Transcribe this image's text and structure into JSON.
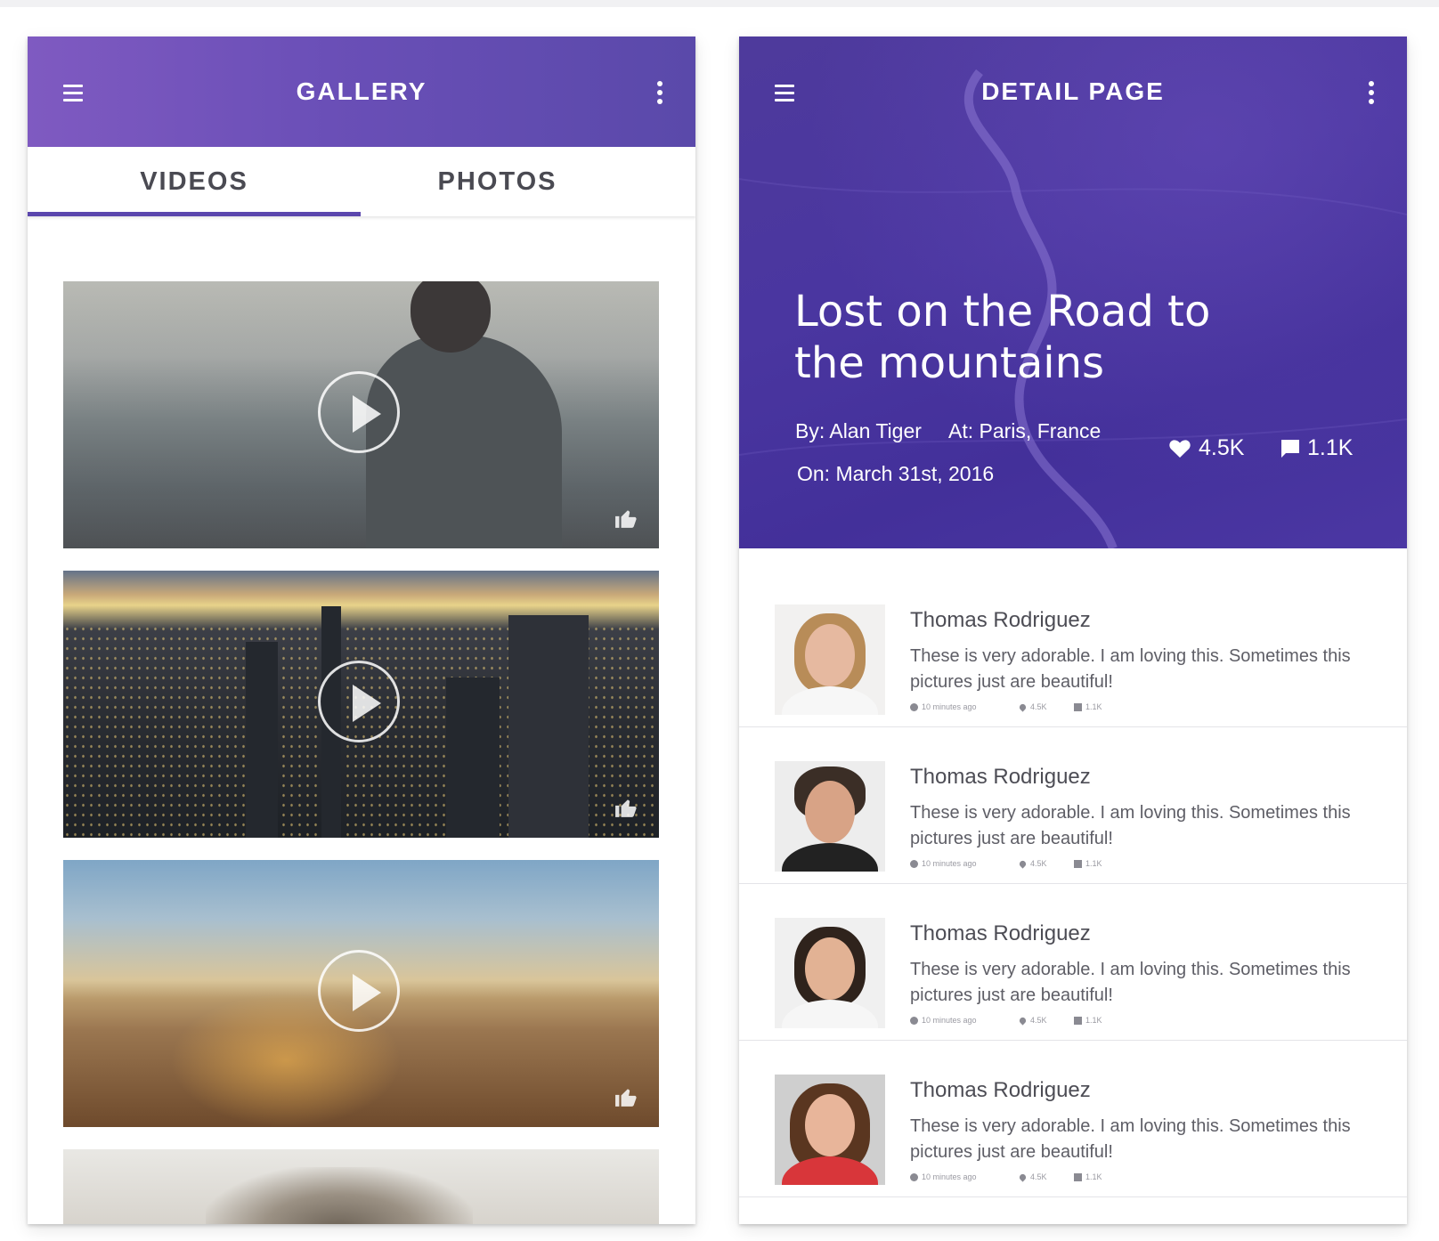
{
  "gallery": {
    "title": "GALLERY",
    "tabs": [
      {
        "label": "VIDEOS",
        "active": true
      },
      {
        "label": "PHOTOS",
        "active": false
      }
    ],
    "videos": [
      {
        "scene": "man-overlooking-valley"
      },
      {
        "scene": "city-skyline-dusk"
      },
      {
        "scene": "beach-sunset"
      },
      {
        "scene": "cat-closeup"
      }
    ],
    "icons": {
      "menu": "menu-icon",
      "more": "more-vert-icon",
      "play": "play-icon",
      "like": "thumb-up-icon"
    }
  },
  "detail": {
    "title": "DETAIL PAGE",
    "post_title": "Lost on the Road to the mountains",
    "author": "By: Alan Tiger",
    "location": "At: Paris, France",
    "date": "On: March 31st, 2016",
    "likes": "4.5K",
    "comments_count": "1.1K",
    "comments": [
      {
        "name": "Thomas Rodriguez",
        "text": "These is very adorable. I am loving this. Sometimes this pictures just are beautiful!",
        "time": "10 minutes ago",
        "likes": "4.5K",
        "replies": "1.1K"
      },
      {
        "name": "Thomas Rodriguez",
        "text": "These is very adorable. I am loving this. Sometimes this pictures just are beautiful!",
        "time": "10 minutes ago",
        "likes": "4.5K",
        "replies": "1.1K"
      },
      {
        "name": "Thomas Rodriguez",
        "text": "These is very adorable. I am loving this. Sometimes this pictures just are beautiful!",
        "time": "10 minutes ago",
        "likes": "4.5K",
        "replies": "1.1K"
      },
      {
        "name": "Thomas Rodriguez",
        "text": "These is very adorable. I am loving this. Sometimes this pictures just are beautiful!",
        "time": "10 minutes ago",
        "likes": "4.5K",
        "replies": "1.1K"
      }
    ]
  },
  "colors": {
    "primary": "#5a46ad",
    "primary_light": "#7f5ac1",
    "hero": "#4a36a0",
    "text": "#4d4d55"
  }
}
